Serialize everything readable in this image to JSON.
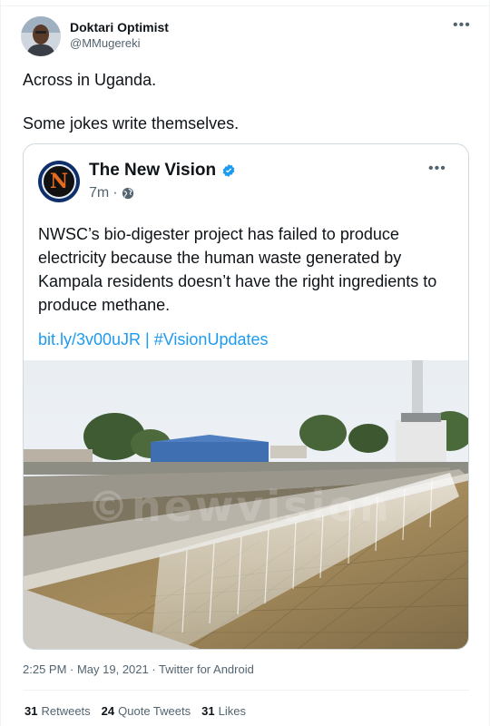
{
  "author": {
    "display_name": "Doktari Optimist",
    "handle": "@MMugereki"
  },
  "tweet": {
    "lines": [
      "Across in Uganda.",
      "Some jokes write themselves."
    ]
  },
  "quoted": {
    "name": "The New Vision",
    "logo_letter": "N",
    "time": "7m",
    "text": "NWSC’s bio-digester project has failed to produce electricity because the human waste generated by Kampala residents doesn’t have the right ingredients to produce methane.",
    "link_text": "bit.ly/3v00uJR | #VisionUpdates",
    "watermark": "©newvision"
  },
  "meta": {
    "timestamp": "2:25 PM · May 19, 2021 · Twitter for Android"
  },
  "stats": {
    "retweets_count": "31",
    "retweets_label": "Retweets",
    "quotes_count": "24",
    "quotes_label": "Quote Tweets",
    "likes_count": "31",
    "likes_label": "Likes"
  },
  "colors": {
    "accent": "#1d9bf0",
    "text": "#0f1419",
    "muted": "#536471",
    "border": "#cfd9de"
  },
  "icons": {
    "more": "more-horizontal-icon",
    "verified": "verified-badge-icon",
    "globe": "globe-icon"
  }
}
